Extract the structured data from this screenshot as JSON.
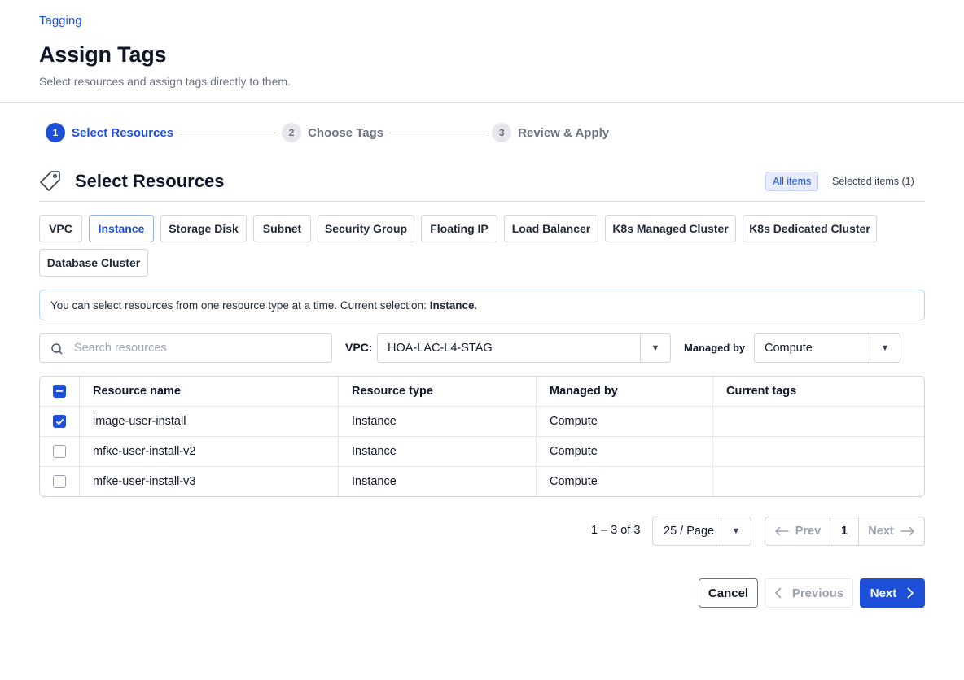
{
  "breadcrumb": "Tagging",
  "page": {
    "title": "Assign Tags",
    "subtitle": "Select resources and assign tags directly to them."
  },
  "stepper": [
    {
      "num": "1",
      "label": "Select Resources",
      "active": true
    },
    {
      "num": "2",
      "label": "Choose Tags",
      "active": false
    },
    {
      "num": "3",
      "label": "Review & Apply",
      "active": false
    }
  ],
  "section": {
    "title": "Select Resources",
    "view_all": "All items",
    "view_selected": "Selected items (1)"
  },
  "resource_types": [
    {
      "label": "VPC",
      "active": false
    },
    {
      "label": "Instance",
      "active": true
    },
    {
      "label": "Storage Disk",
      "active": false
    },
    {
      "label": "Subnet",
      "active": false
    },
    {
      "label": "Security Group",
      "active": false
    },
    {
      "label": "Floating IP",
      "active": false
    },
    {
      "label": "Load Balancer",
      "active": false
    },
    {
      "label": "K8s Managed Cluster",
      "active": false
    },
    {
      "label": "K8s Dedicated Cluster",
      "active": false
    },
    {
      "label": "Database Cluster",
      "active": false
    }
  ],
  "info": {
    "text": "You can select resources from one resource type at a time. Current selection:",
    "selection": "Instance",
    "suffix": "."
  },
  "filters": {
    "search_placeholder": "Search resources",
    "search_value": "",
    "vpc_label": "VPC:",
    "vpc_value": "HOA-LAC-L4-STAG",
    "managed_label": "Managed by",
    "managed_value": "Compute"
  },
  "table": {
    "columns": [
      "Resource name",
      "Resource type",
      "Managed by",
      "Current tags"
    ],
    "rows": [
      {
        "name": "image-user-install",
        "type": "Instance",
        "managed": "Compute",
        "tags": "",
        "checked": true
      },
      {
        "name": "mfke-user-install-v2",
        "type": "Instance",
        "managed": "Compute",
        "tags": "",
        "checked": false
      },
      {
        "name": "mfke-user-install-v3",
        "type": "Instance",
        "managed": "Compute",
        "tags": "",
        "checked": false
      }
    ]
  },
  "pagination": {
    "range": "1 – 3 of 3",
    "page_size": "25 / Page",
    "prev": "Prev",
    "current": "1",
    "next": "Next"
  },
  "footer": {
    "cancel": "Cancel",
    "previous": "Previous",
    "next": "Next"
  },
  "colors": {
    "primary": "#1e4fd8",
    "border": "#d1d5db",
    "muted": "#6b7280"
  }
}
